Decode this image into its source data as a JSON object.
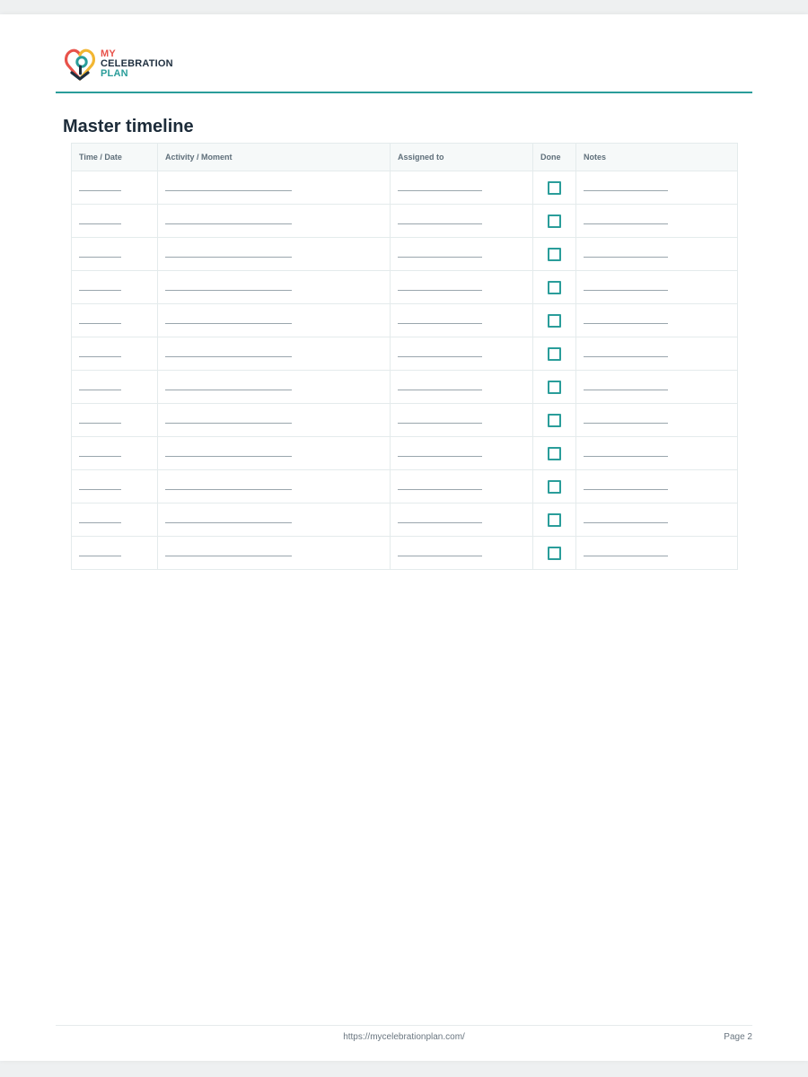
{
  "brand": {
    "line1": "MY",
    "line2": "CELEBRATION",
    "line3": "PLAN",
    "colors": {
      "coral": "#e8524a",
      "navy": "#1f2f3f",
      "teal": "#2a9d9a",
      "yellow": "#f2b632"
    },
    "icon": "heart-location-pin-icon"
  },
  "title": "Master timeline",
  "table": {
    "columns": [
      "Time / Date",
      "Activity / Moment",
      "Assigned to",
      "Done",
      "Notes"
    ],
    "row_count": 12,
    "rows": [
      {
        "done": false
      },
      {
        "done": false
      },
      {
        "done": false
      },
      {
        "done": false
      },
      {
        "done": false
      },
      {
        "done": false
      },
      {
        "done": false
      },
      {
        "done": false
      },
      {
        "done": false
      },
      {
        "done": false
      },
      {
        "done": false
      },
      {
        "done": false
      }
    ]
  },
  "footer": {
    "url": "https://mycelebrationplan.com/",
    "page": "Page 2"
  }
}
